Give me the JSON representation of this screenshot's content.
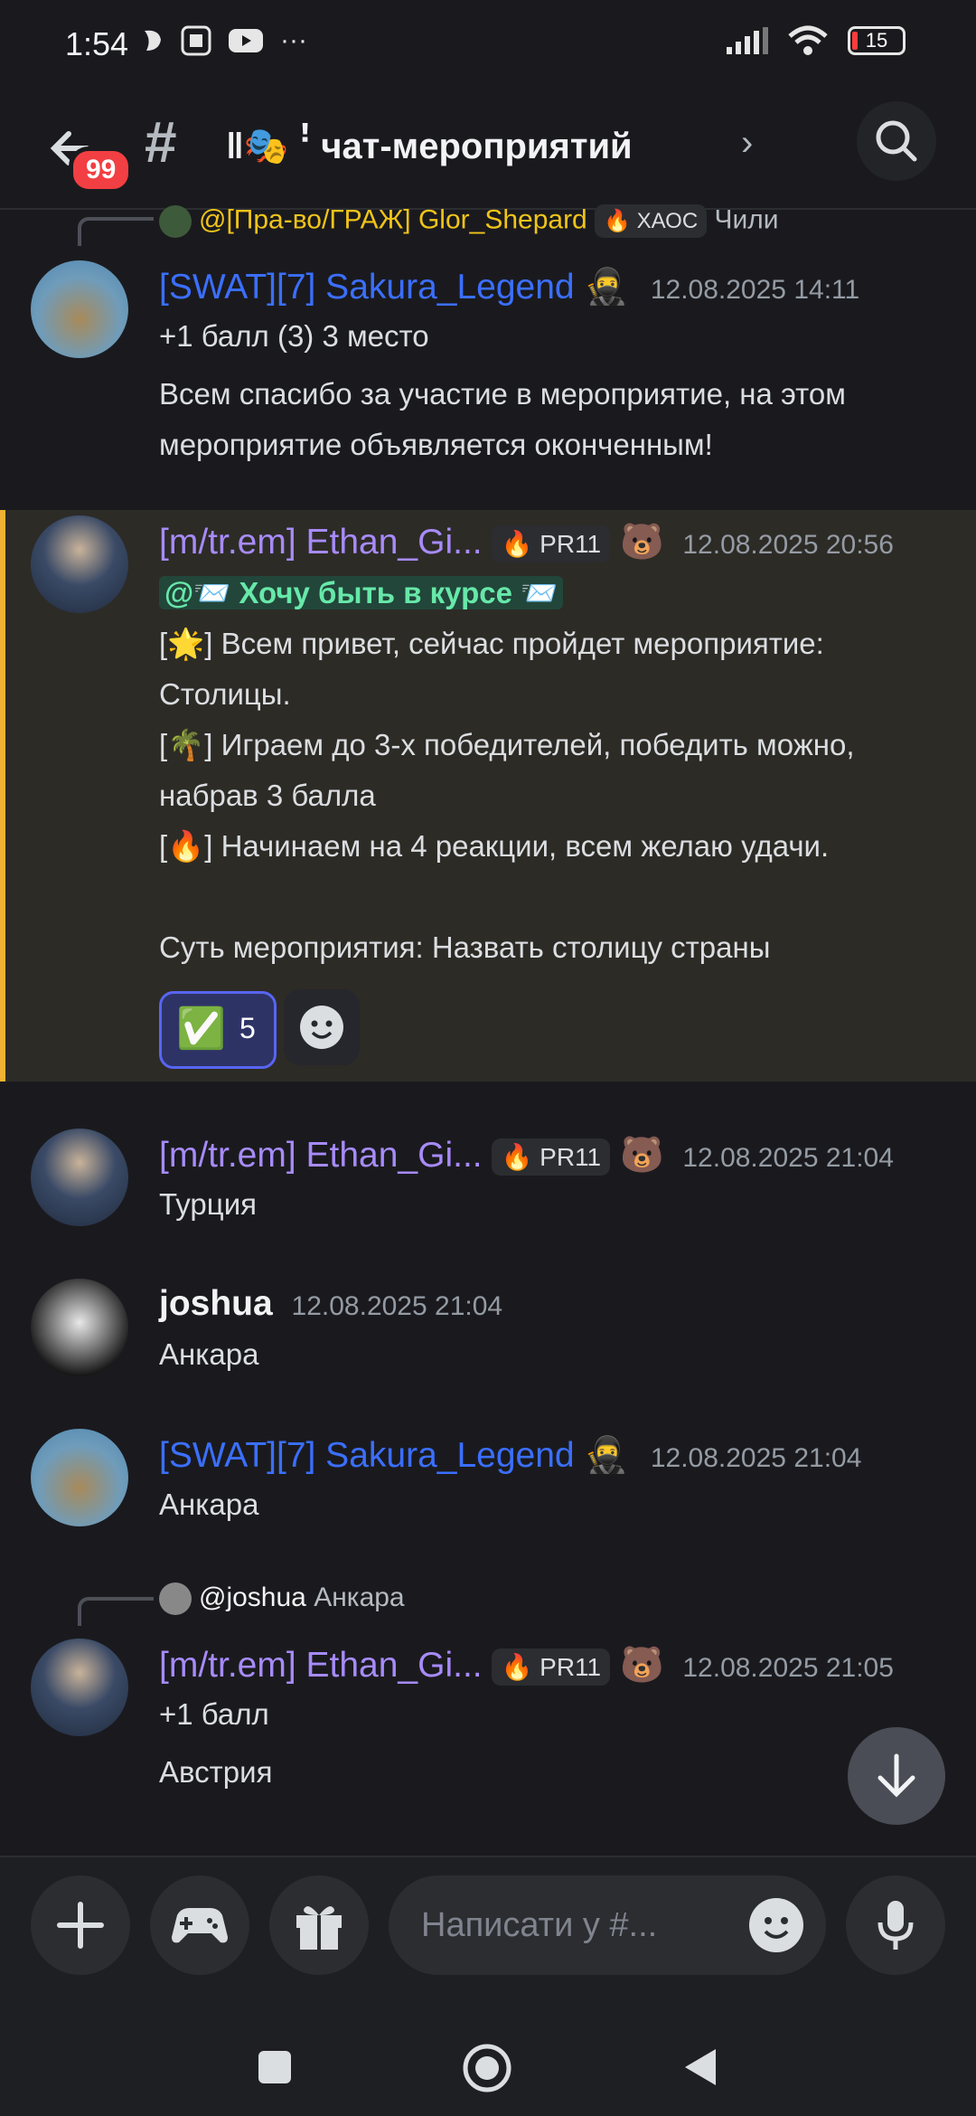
{
  "status_bar": {
    "time": "1:54",
    "more": "···",
    "battery": "15"
  },
  "header": {
    "badge": "99",
    "channel_prefix": "#",
    "channel_name": "ǁ🎭 ꜝ чат-мероприятий",
    "chevron": "›"
  },
  "messages": [
    {
      "reply_to": "@[Пра-во/ГРАЖ] Glor_Shepard",
      "reply_role": "ХАОС",
      "reply_text": "Чили",
      "author": "[SWAT][7] Sakura_Legend",
      "time": "12.08.2025 14:11",
      "lines": [
        "+1 балл (3) 3 место",
        "Всем спасибо за участие в мероприятие, на этом мероприятие объявляется оконченным!"
      ]
    },
    {
      "author": "[m/tr.em] Ethan_Gi...",
      "role": "PR11",
      "time": "12.08.2025 20:56",
      "mention": "@📨 Хочу быть в курсе 📨",
      "lines": [
        "[🌟] Всем привет, сейчас пройдет мероприятие: Столицы.",
        "[🌴] Играем до 3-х победителей, победить можно, набрав 3 балла",
        "[🔥] Начинаем на 4 реакции, всем желаю удачи.",
        "Суть мероприятия: Назвать столицу страны"
      ],
      "reaction_emoji": "✅",
      "reaction_count": "5"
    },
    {
      "author": "[m/tr.em] Ethan_Gi...",
      "role": "PR11",
      "time": "12.08.2025 21:04",
      "text": "Турция"
    },
    {
      "author": "joshua",
      "time": "12.08.2025 21:04",
      "text": "Анкара"
    },
    {
      "author": "[SWAT][7] Sakura_Legend",
      "time": "12.08.2025 21:04",
      "text": "Анкара"
    },
    {
      "reply_to": "@joshua",
      "reply_text": "Анкара",
      "author": "[m/tr.em] Ethan_Gi...",
      "role": "PR11",
      "time": "12.08.2025 21:05",
      "lines": [
        "+1 балл",
        "Австрия"
      ]
    }
  ],
  "composer": {
    "placeholder": "Написати у #..."
  },
  "colors": {
    "accent_blue": "#3b6fff",
    "accent_purple": "#a78bfa",
    "highlight_bar": "#f0b232",
    "reply_name": "#f0c419"
  }
}
